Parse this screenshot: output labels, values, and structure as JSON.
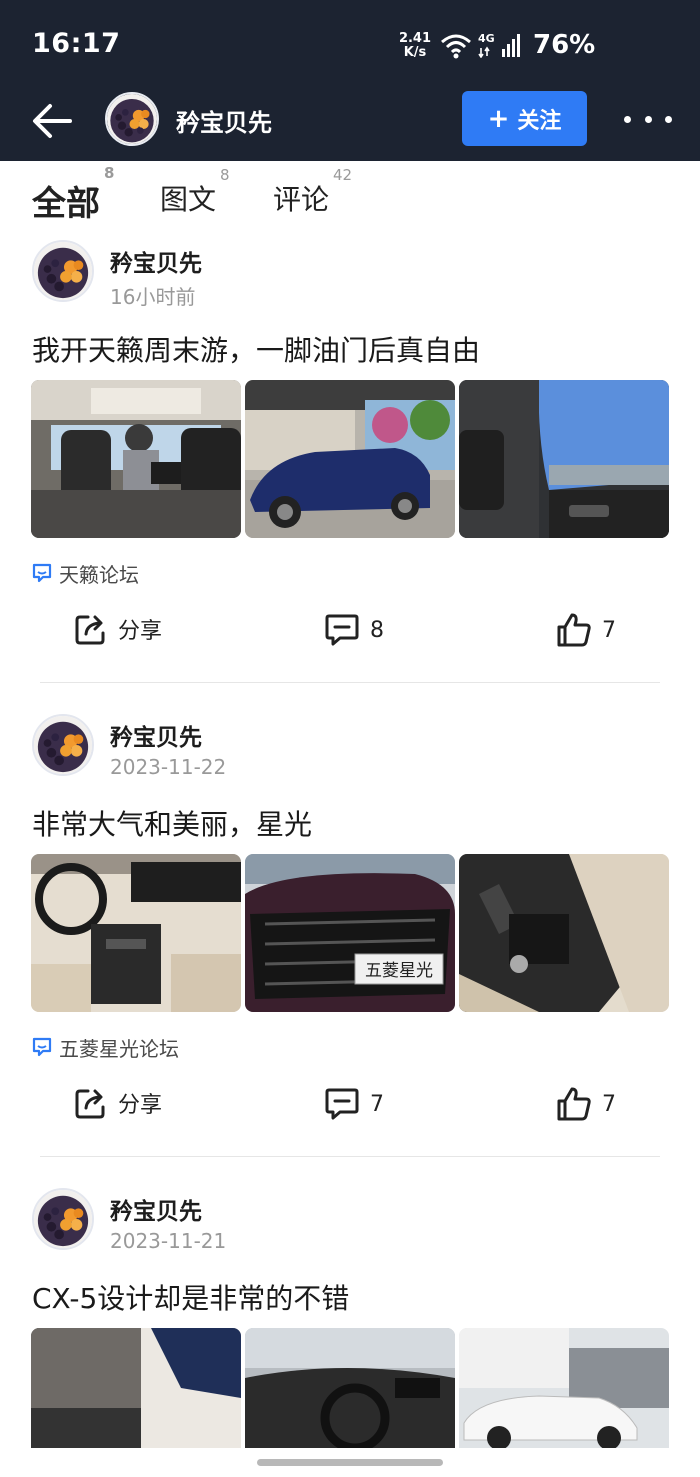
{
  "status_bar": {
    "time": "16:17",
    "net_speed_value": "2.41",
    "net_speed_unit": "K/s",
    "network": "4G",
    "battery": "76%"
  },
  "nav": {
    "back_icon": "arrow-left-icon",
    "username": "矜宝贝先",
    "follow_label": "关注",
    "more_icon": "more-dots-icon"
  },
  "tabs": [
    {
      "label": "全部",
      "count": "8",
      "active": true
    },
    {
      "label": "图文",
      "count": "8",
      "active": false
    },
    {
      "label": "评论",
      "count": "42",
      "active": false
    }
  ],
  "posts": [
    {
      "author": "矜宝贝先",
      "time": "16小时前",
      "title": "我开天籁周末游，一脚油门后真自由",
      "forum": "天籁论坛",
      "share_label": "分享",
      "comments": "8",
      "likes": "7"
    },
    {
      "author": "矜宝贝先",
      "time": "2023-11-22",
      "title": "非常大气和美丽，星光",
      "forum": "五菱星光论坛",
      "share_label": "分享",
      "comments": "7",
      "likes": "7",
      "photo_plate_text": "五菱星光"
    },
    {
      "author": "矜宝贝先",
      "time": "2023-11-21",
      "title": "CX-5设计却是非常的不错"
    }
  ],
  "colors": {
    "header_bg": "#1c2331",
    "accent": "#2f7bf5",
    "forum_icon": "#2f7bf5"
  }
}
